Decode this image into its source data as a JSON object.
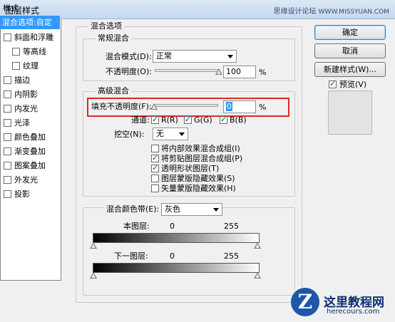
{
  "window": {
    "title": "图层样式",
    "watermark": "思缘设计论坛",
    "watermark_site": "WWW.MISSYUAN.COM"
  },
  "styles_list": {
    "header": "样式",
    "selected": "混合选项:自定",
    "items": [
      "斜面和浮雕",
      "等高线",
      "纹理",
      "描边",
      "内阴影",
      "内发光",
      "光泽",
      "颜色叠加",
      "渐变叠加",
      "图案叠加",
      "外发光",
      "投影"
    ]
  },
  "blending": {
    "group_title": "混合选项",
    "general": {
      "title": "常规混合",
      "blend_mode_label": "混合模式(D):",
      "blend_mode_value": "正常",
      "opacity_label": "不透明度(O):",
      "opacity_value": "100",
      "opacity_level_percent": 100,
      "unit": "%"
    },
    "advanced": {
      "title": "高级混合",
      "fill_opacity_label": "填充不透明度(F):",
      "fill_opacity_value": "0",
      "fill_opacity_level_percent": 0,
      "unit": "%",
      "channels_label": "通道:",
      "channel_r": "R(R)",
      "channel_g": "G(G)",
      "channel_b": "B(B)",
      "knockout_label": "挖空(N):",
      "knockout_value": "无",
      "options": [
        {
          "label": "将内部效果混合成组(I)",
          "checked": false
        },
        {
          "label": "将剪贴图层混合成组(P)",
          "checked": true
        },
        {
          "label": "透明形状图层(T)",
          "checked": true
        },
        {
          "label": "图层蒙版隐藏效果(S)",
          "checked": false
        },
        {
          "label": "矢量蒙版隐藏效果(H)",
          "checked": false
        }
      ]
    },
    "blend_if": {
      "label": "混合颜色带(E):",
      "value": "灰色",
      "this_layer_label": "本图层:",
      "this_layer_min": "0",
      "this_layer_max": "255",
      "underlying_label": "下一图层:",
      "underlying_min": "0",
      "underlying_max": "255"
    }
  },
  "buttons": {
    "ok": "确定",
    "cancel": "取消",
    "new_style": "新建样式(W)...",
    "preview_label": "预览(V)",
    "preview_checked": true
  },
  "footer_watermark": {
    "logo_letter": "Z",
    "name": "这里教程网",
    "url": "herecours.com"
  },
  "colors": {
    "selection": "#3399ff",
    "highlight_box": "#e0262a",
    "watermark_blue": "#0d2f72"
  }
}
